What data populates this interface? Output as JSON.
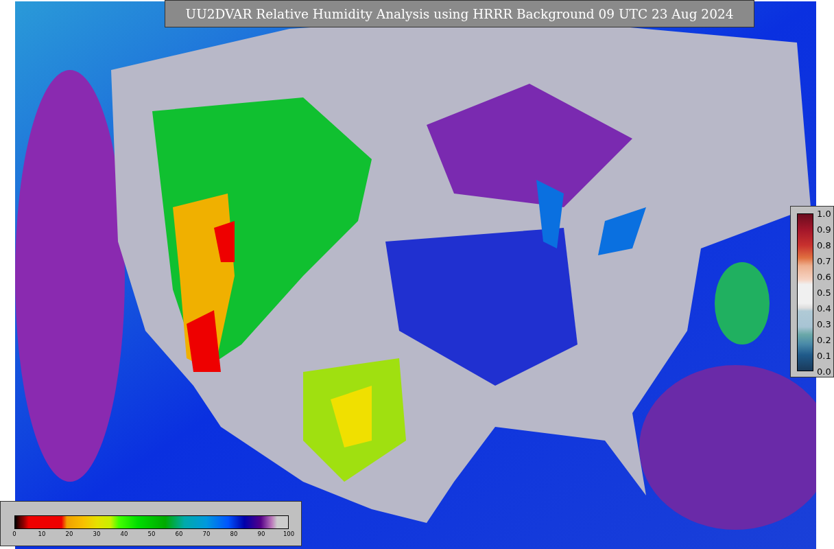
{
  "title": "UU2DVAR Relative Humidity Analysis using HRRR Background 09 UTC 23 Aug 2024",
  "humidity_legend": {
    "ticks": [
      "0",
      "10",
      "20",
      "30",
      "40",
      "50",
      "60",
      "70",
      "80",
      "90",
      "100"
    ]
  },
  "station_legend": {
    "ticks": [
      "1.0",
      "0.9",
      "0.8",
      "0.7",
      "0.6",
      "0.5",
      "0.4",
      "0.3",
      "0.2",
      "0.1",
      "0.0"
    ]
  }
}
